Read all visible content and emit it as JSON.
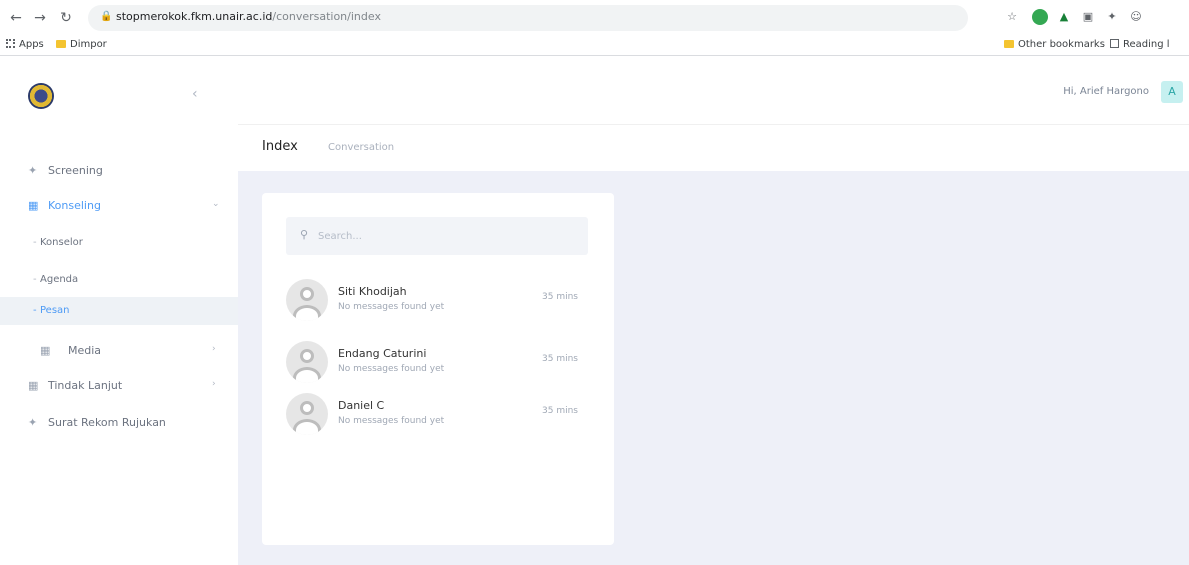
{
  "browser": {
    "url_host": "stopmerokok.fkm.unair.ac.id",
    "url_path": "/conversation/index",
    "bookmarks_left": [
      "Apps",
      "Dimpor"
    ],
    "bookmarks_right": [
      "Other bookmarks",
      "Reading l"
    ]
  },
  "sidebar": {
    "items": [
      {
        "label": "Screening"
      },
      {
        "label": "Konseling"
      },
      {
        "label": "Media"
      },
      {
        "label": "Tindak Lanjut"
      },
      {
        "label": "Surat Rekom Rujukan"
      }
    ],
    "sub_items": [
      {
        "label": "Konselor"
      },
      {
        "label": "Agenda"
      },
      {
        "label": "Pesan"
      }
    ]
  },
  "topbar": {
    "greeting": "Hi, Arief Hargono",
    "avatar_letter": "A"
  },
  "subheader": {
    "title": "Index",
    "crumb": "Conversation"
  },
  "search": {
    "placeholder": "Search..."
  },
  "conversations": [
    {
      "name": "Siti Khodijah",
      "message": "No messages found yet",
      "time": "35 mins"
    },
    {
      "name": "Endang Caturini",
      "message": "No messages found yet",
      "time": "35 mins"
    },
    {
      "name": "Daniel C",
      "message": "No messages found yet",
      "time": "35 mins"
    }
  ],
  "colors": {
    "accent": "#4e9bf5",
    "content_bg": "#eef0f8",
    "avatar_bg": "#c6f0f0"
  }
}
